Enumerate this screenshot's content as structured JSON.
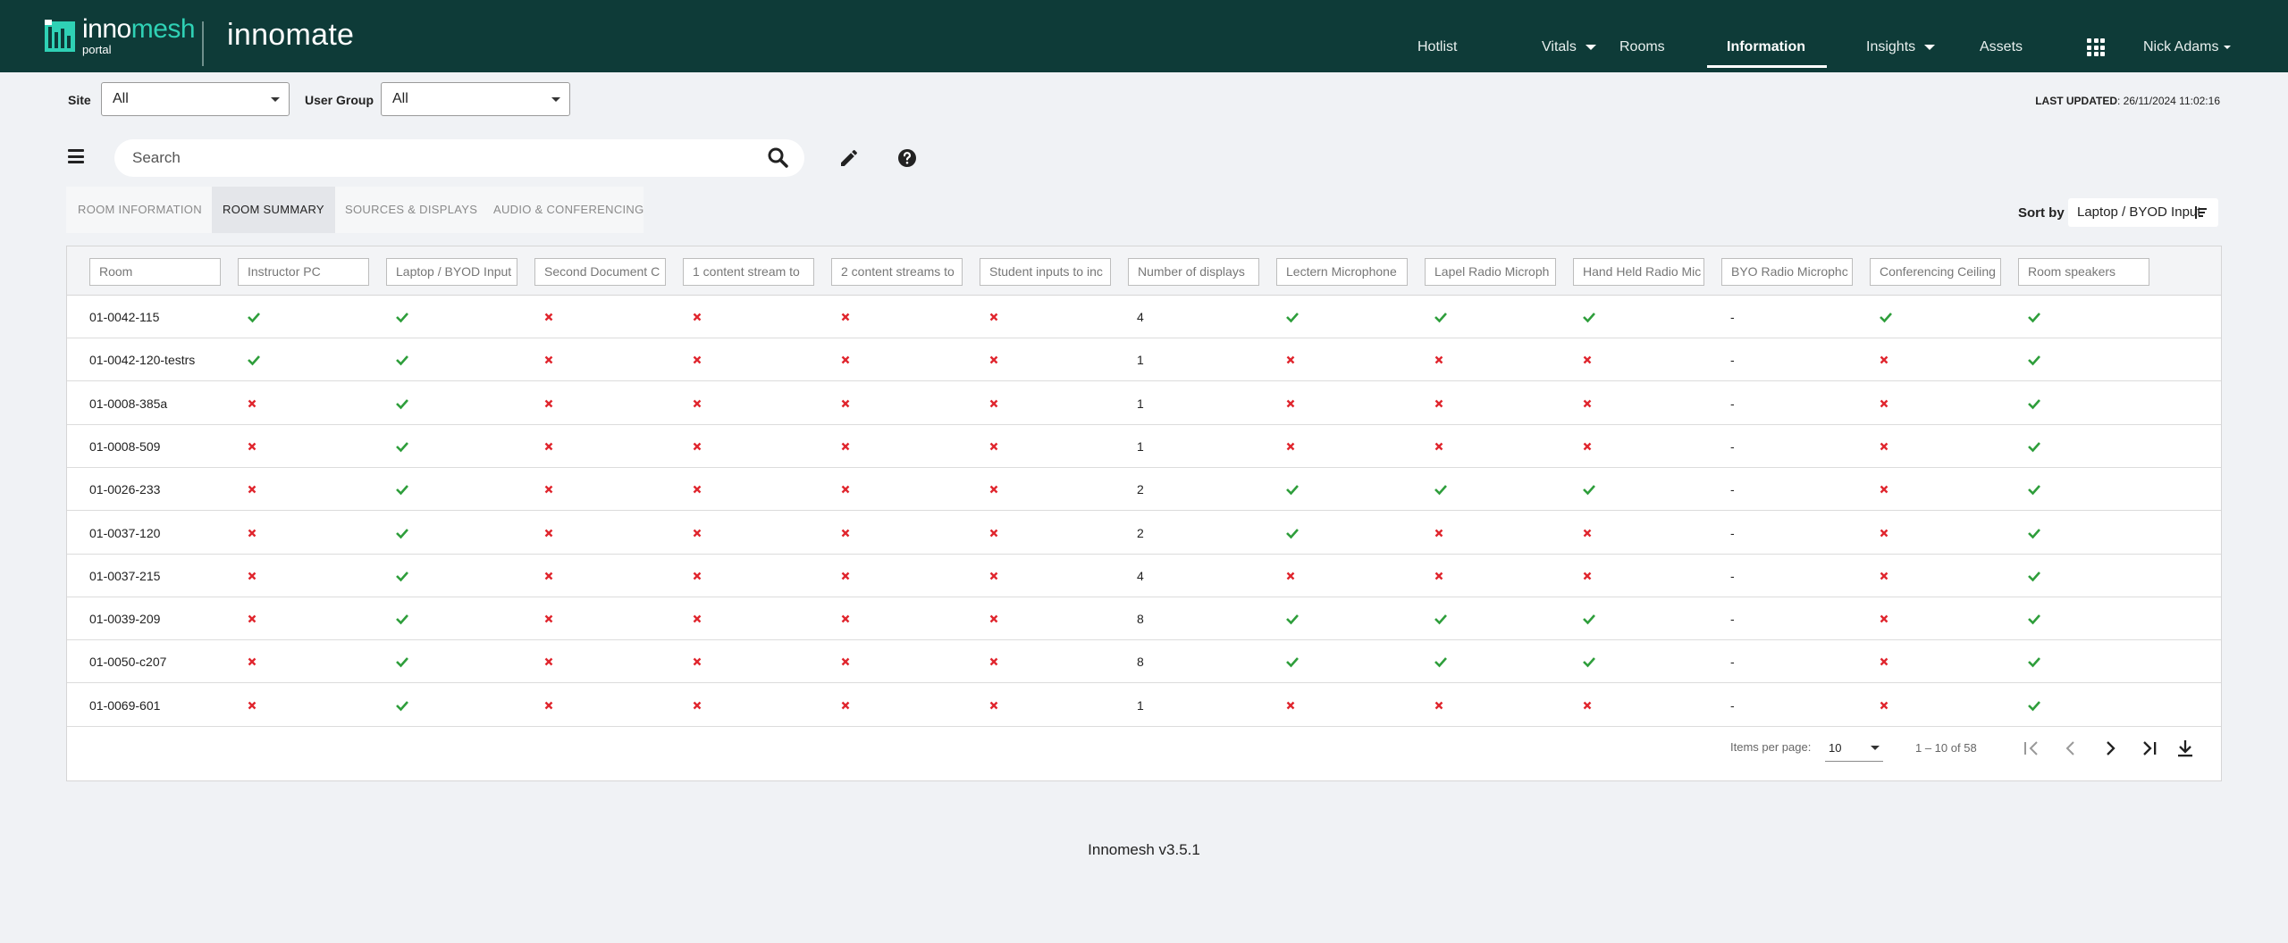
{
  "header": {
    "logo_top": "inno",
    "logo_accent": "mesh",
    "logo_sub": "portal",
    "brand": "innomate",
    "nav": [
      {
        "label": "Hotlist",
        "dropdown": false,
        "active": false
      },
      {
        "label": "Vitals",
        "dropdown": true,
        "active": false
      },
      {
        "label": "Rooms",
        "dropdown": false,
        "active": false
      },
      {
        "label": "Information",
        "dropdown": false,
        "active": true
      },
      {
        "label": "Insights",
        "dropdown": true,
        "active": false
      },
      {
        "label": "Assets",
        "dropdown": false,
        "active": false
      }
    ],
    "user": "Nick Adams"
  },
  "filters": {
    "site_label": "Site",
    "site_value": "All",
    "group_label": "User Group",
    "group_value": "All",
    "last_updated_label": "LAST UPDATED",
    "last_updated_value": ": 26/11/2024 11:02:16"
  },
  "search": {
    "placeholder": "Search"
  },
  "tabs": [
    "ROOM INFORMATION",
    "ROOM SUMMARY",
    "SOURCES & DISPLAYS",
    "AUDIO & CONFERENCING"
  ],
  "active_tab": 1,
  "sort": {
    "label": "Sort by",
    "value": "Laptop / BYOD Input"
  },
  "columns": [
    "Room",
    "Instructor PC",
    "Laptop / BYOD Input",
    "Second Document C",
    "1 content stream to",
    "2 content streams to",
    "Student inputs to inc",
    "Number of displays",
    "Lectern Microphone",
    "Lapel Radio Microph",
    "Hand Held Radio Mic",
    "BYO Radio Microphc",
    "Conferencing Ceiling",
    "Room speakers"
  ],
  "rows": [
    {
      "room": "01-0042-115",
      "values": [
        "ok",
        "ok",
        "no",
        "no",
        "no",
        "no",
        "4",
        "ok",
        "ok",
        "ok",
        "-",
        "ok",
        "ok"
      ]
    },
    {
      "room": "01-0042-120-testrs",
      "values": [
        "ok",
        "ok",
        "no",
        "no",
        "no",
        "no",
        "1",
        "no",
        "no",
        "no",
        "-",
        "no",
        "ok"
      ]
    },
    {
      "room": "01-0008-385a",
      "values": [
        "no",
        "ok",
        "no",
        "no",
        "no",
        "no",
        "1",
        "no",
        "no",
        "no",
        "-",
        "no",
        "ok"
      ]
    },
    {
      "room": "01-0008-509",
      "values": [
        "no",
        "ok",
        "no",
        "no",
        "no",
        "no",
        "1",
        "no",
        "no",
        "no",
        "-",
        "no",
        "ok"
      ]
    },
    {
      "room": "01-0026-233",
      "values": [
        "no",
        "ok",
        "no",
        "no",
        "no",
        "no",
        "2",
        "ok",
        "ok",
        "ok",
        "-",
        "no",
        "ok"
      ]
    },
    {
      "room": "01-0037-120",
      "values": [
        "no",
        "ok",
        "no",
        "no",
        "no",
        "no",
        "2",
        "ok",
        "no",
        "no",
        "-",
        "no",
        "ok"
      ]
    },
    {
      "room": "01-0037-215",
      "values": [
        "no",
        "ok",
        "no",
        "no",
        "no",
        "no",
        "4",
        "no",
        "no",
        "no",
        "-",
        "no",
        "ok"
      ]
    },
    {
      "room": "01-0039-209",
      "values": [
        "no",
        "ok",
        "no",
        "no",
        "no",
        "no",
        "8",
        "ok",
        "ok",
        "ok",
        "-",
        "no",
        "ok"
      ]
    },
    {
      "room": "01-0050-c207",
      "values": [
        "no",
        "ok",
        "no",
        "no",
        "no",
        "no",
        "8",
        "ok",
        "ok",
        "ok",
        "-",
        "no",
        "ok"
      ]
    },
    {
      "room": "01-0069-601",
      "values": [
        "no",
        "ok",
        "no",
        "no",
        "no",
        "no",
        "1",
        "no",
        "no",
        "no",
        "-",
        "no",
        "ok"
      ]
    }
  ],
  "paginator": {
    "items_label": "Items per page:",
    "items_value": "10",
    "range": "1 – 10 of 58"
  },
  "footer": "Innomesh v3.5.1",
  "colors": {
    "header_bg": "#0e3b38",
    "accent": "#2fd1b5",
    "ok": "#2e9e3b",
    "no": "#e0262e"
  }
}
